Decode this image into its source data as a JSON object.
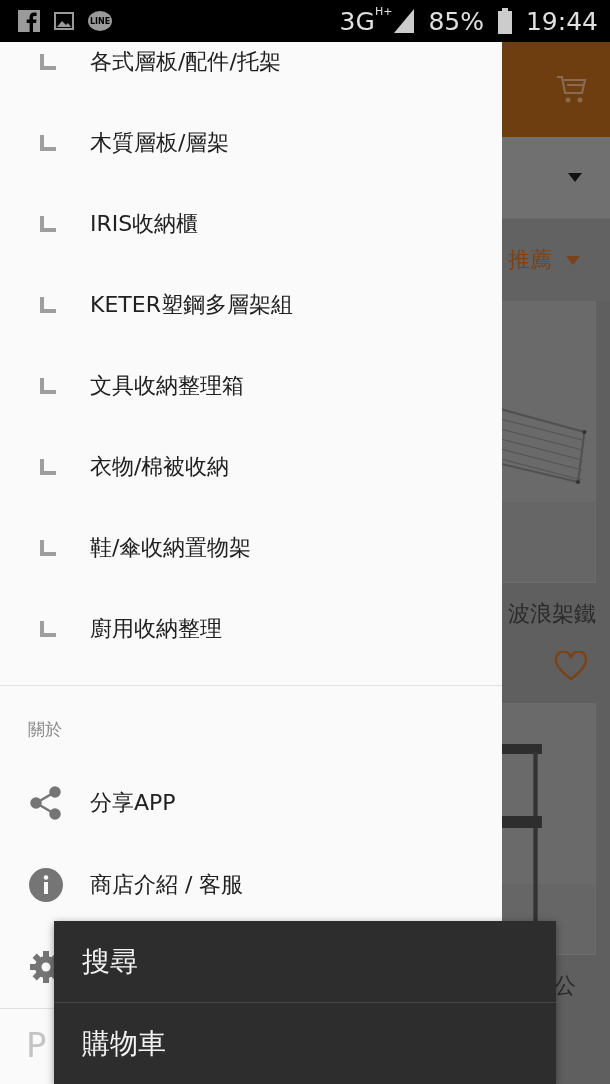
{
  "status_bar": {
    "notifications": [
      {
        "kind": "facebook"
      },
      {
        "kind": "gallery"
      },
      {
        "kind": "chat",
        "label": "LINE"
      }
    ],
    "network": "3G",
    "network_sub": "H+",
    "battery": "85%",
    "time": "19:44"
  },
  "background": {
    "sort_label": "推薦",
    "products": [
      {
        "name": "波浪架鐵",
        "favorite": false
      },
      {
        "name": "公"
      }
    ]
  },
  "drawer": {
    "categories": [
      {
        "label": "各式層板/配件/托架"
      },
      {
        "label": "木質層板/層架"
      },
      {
        "label": "IRIS收納櫃"
      },
      {
        "label": "KETER塑鋼多層架組"
      },
      {
        "label": "文具收納整理箱"
      },
      {
        "label": "衣物/棉被收納"
      },
      {
        "label": "鞋/傘收納置物架"
      },
      {
        "label": "廚用收納整理"
      }
    ],
    "section_title": "關於",
    "about_items": [
      {
        "kind": "share",
        "label": "分享APP"
      },
      {
        "kind": "info",
        "label": "商店介紹 / 客服"
      },
      {
        "kind": "settings"
      }
    ],
    "footer": "P"
  },
  "popup_menu": [
    {
      "label": "搜尋"
    },
    {
      "label": "購物車"
    }
  ]
}
